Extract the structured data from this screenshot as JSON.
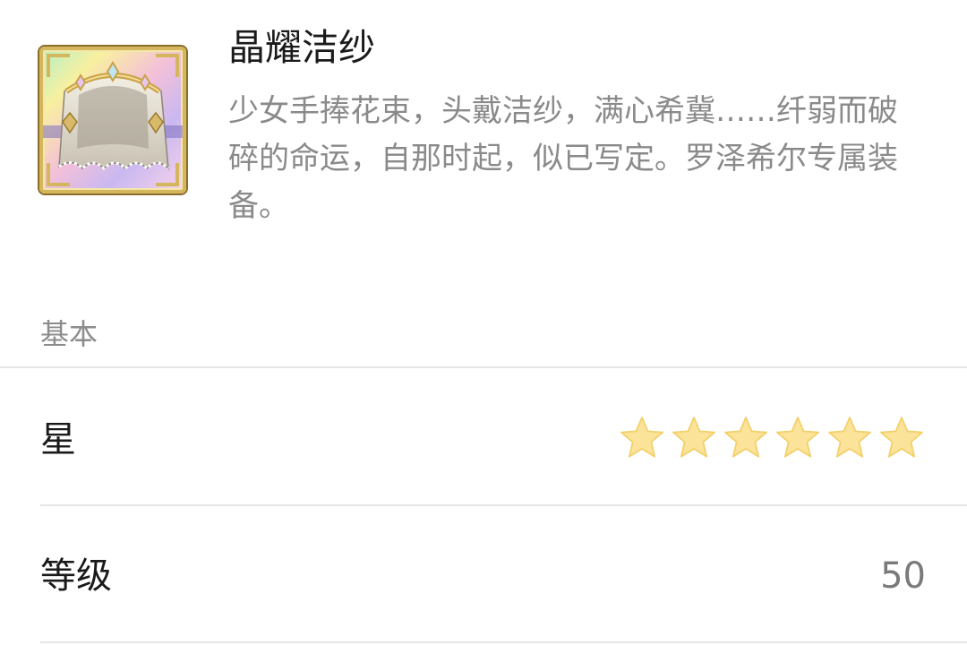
{
  "item": {
    "name": "晶耀洁纱",
    "description": "少女手捧花束，头戴洁纱，满心希冀……纤弱而破碎的命运，自那时起，似已写定。罗泽希尔专属装备。",
    "icon": "bridal-veil-icon"
  },
  "section": {
    "label": "基本"
  },
  "rows": {
    "stars": {
      "label": "星",
      "rating": 6,
      "max": 6,
      "star_color": "#fbe49a",
      "star_outline": "#f3d06a"
    },
    "level": {
      "label": "等级",
      "value": "50"
    }
  }
}
